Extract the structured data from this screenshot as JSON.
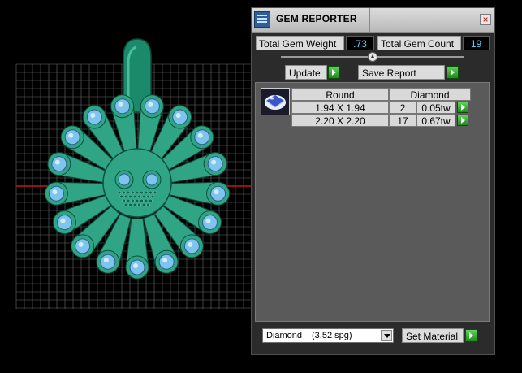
{
  "panel": {
    "title": "GEM REPORTER",
    "close_glyph": "×",
    "total_weight_label": "Total Gem Weight",
    "total_weight_value": ".73",
    "total_count_label": "Total Gem Count",
    "total_count_value": "19",
    "update_label": "Update",
    "save_report_label": "Save Report"
  },
  "report": {
    "thumb_icon": "round-gem-icon",
    "headers": {
      "shape": "Round",
      "material": "Diamond"
    },
    "rows": [
      {
        "size": "1.94 X 1.94",
        "count": "2",
        "weight": "0.05tw"
      },
      {
        "size": "2.20 X 2.20",
        "count": "17",
        "weight": "0.67tw"
      }
    ]
  },
  "material": {
    "selected_name": "Diamond",
    "selected_spg": "(3.52 spg)",
    "set_material_label": "Set Material"
  },
  "colors": {
    "gem_metal": "#2fa585",
    "stone": "#7fc4ee",
    "grid": "#6a6a6a",
    "value_text": "#5ad8ff",
    "go_button": "#3cba38"
  }
}
